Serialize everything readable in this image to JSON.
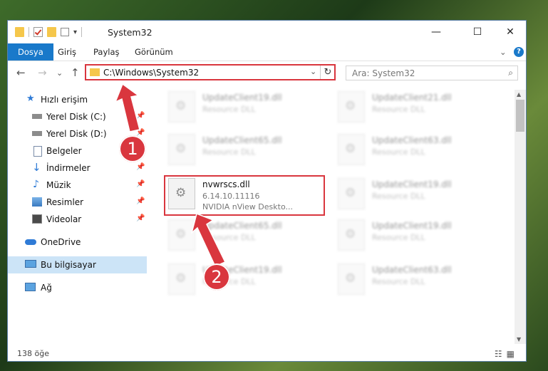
{
  "window": {
    "title": "System32",
    "minimize_label": "—",
    "maximize_label": "☐",
    "close_label": "✕"
  },
  "ribbon": {
    "tabs": [
      "Dosya",
      "Giriş",
      "Paylaş",
      "Görünüm"
    ],
    "expand_label": "⌄",
    "help_label": "?"
  },
  "navigation": {
    "back_label": "←",
    "forward_label": "→",
    "recent_label": "⌄",
    "up_label": "↑",
    "address": "C:\\Windows\\System32",
    "address_dropdown": "⌄",
    "refresh_label": "↻",
    "search_placeholder": "Ara: System32",
    "search_icon": "⌕"
  },
  "sidebar": {
    "items": [
      {
        "label": "Hızlı erişim",
        "icon": "star-icon",
        "pinned": false
      },
      {
        "label": "Yerel Disk (C:)",
        "icon": "drive-icon",
        "pinned": true
      },
      {
        "label": "Yerel Disk (D:)",
        "icon": "drive-icon",
        "pinned": true
      },
      {
        "label": "Belgeler",
        "icon": "document-icon",
        "pinned": true
      },
      {
        "label": "İndirmeler",
        "icon": "download-icon",
        "pinned": true
      },
      {
        "label": "Müzik",
        "icon": "music-icon",
        "pinned": true
      },
      {
        "label": "Resimler",
        "icon": "picture-icon",
        "pinned": true
      },
      {
        "label": "Videolar",
        "icon": "video-icon",
        "pinned": true
      },
      {
        "label": "OneDrive",
        "icon": "cloud-icon",
        "pinned": false
      },
      {
        "label": "Bu bilgisayar",
        "icon": "computer-icon",
        "pinned": false
      },
      {
        "label": "Ağ",
        "icon": "network-icon",
        "pinned": false
      }
    ],
    "pin_glyph": "📌"
  },
  "files": [
    {
      "name": "UpdateClient19.dll",
      "type": "Resource DLL"
    },
    {
      "name": "UpdateClient21.dll",
      "type": "Resource DLL"
    },
    {
      "name": "UpdateClient65.dll",
      "type": "Resource DLL"
    },
    {
      "name": "UpdateClient63.dll",
      "type": "Resource DLL"
    },
    {
      "name": "nvwrscs.dll",
      "version": "6.14.10.11116",
      "description": "NVIDIA nView Deskto..."
    },
    {
      "name": "UpdateClient19.dll",
      "type": "Resource DLL"
    },
    {
      "name": "UpdateClient65.dll",
      "type": "Resource DLL"
    },
    {
      "name": "UpdateClient19.dll",
      "type": "Resource DLL"
    },
    {
      "name": "UpdateClient19.dll",
      "type": "Resource DLL"
    },
    {
      "name": "UpdateClient63.dll",
      "type": "Resource DLL"
    }
  ],
  "callouts": [
    "1",
    "2"
  ],
  "status": {
    "item_count": "138 öğe"
  },
  "colors": {
    "accent": "#1979ca",
    "highlight": "#d9363e",
    "folder": "#f5c74b",
    "selected_nav": "#cce4f7"
  }
}
